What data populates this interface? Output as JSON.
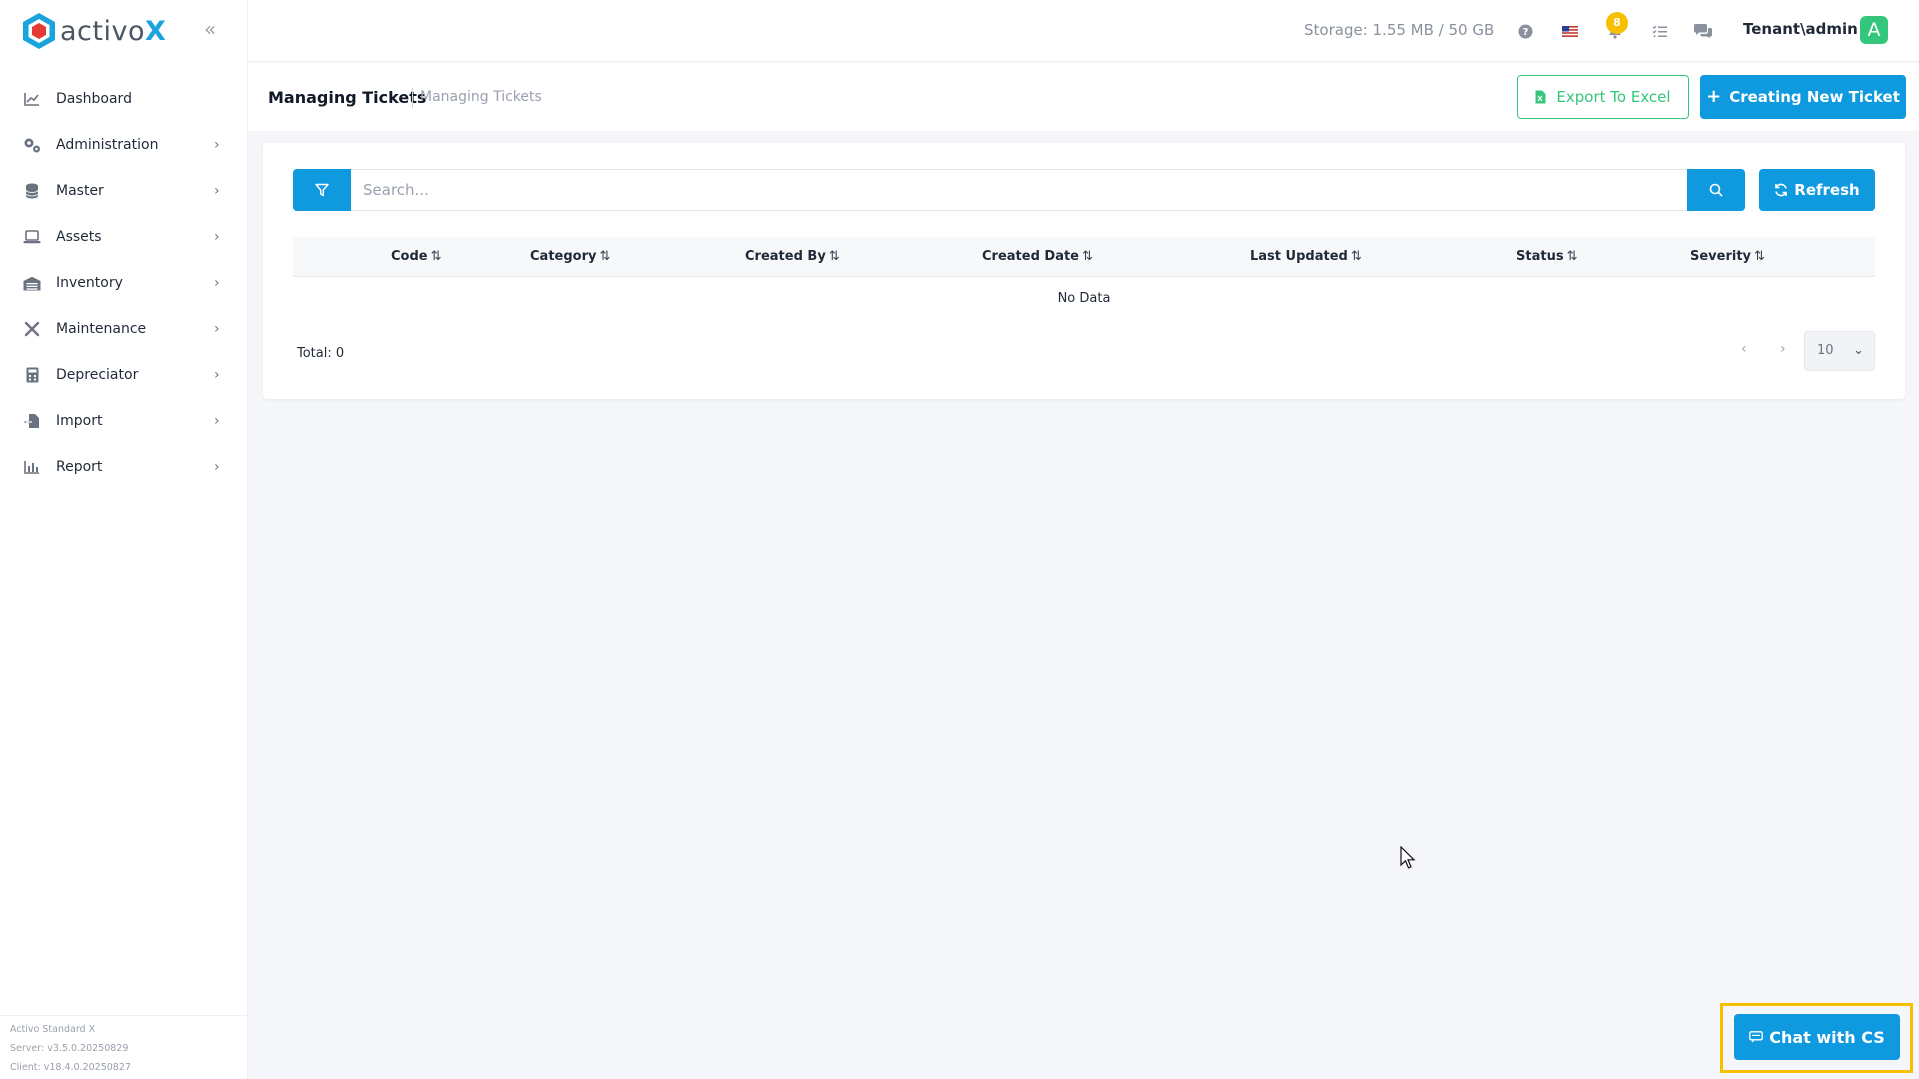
{
  "app": {
    "logo_text": "activo",
    "logo_x": "X"
  },
  "sidebar": {
    "collapse_icon": "double-chevron-left-icon",
    "items": [
      {
        "label": "Dashboard",
        "icon": "chart-line-icon",
        "has_children": false
      },
      {
        "label": "Administration",
        "icon": "gears-icon",
        "has_children": true
      },
      {
        "label": "Master",
        "icon": "database-icon",
        "has_children": true
      },
      {
        "label": "Assets",
        "icon": "laptop-icon",
        "has_children": true
      },
      {
        "label": "Inventory",
        "icon": "warehouse-icon",
        "has_children": true
      },
      {
        "label": "Maintenance",
        "icon": "tools-icon",
        "has_children": true
      },
      {
        "label": "Depreciator",
        "icon": "calculator-icon",
        "has_children": true
      },
      {
        "label": "Import",
        "icon": "file-import-icon",
        "has_children": true
      },
      {
        "label": "Report",
        "icon": "chart-bar-icon",
        "has_children": true
      }
    ],
    "version": {
      "product": "Activo Standard X",
      "server": "Server: v3.5.0.20250829",
      "client": "Client: v18.4.0.20250827"
    }
  },
  "topbar": {
    "storage": "Storage: 1.55 MB / 50 GB",
    "notification_count": "8",
    "user": "Tenant\\admin",
    "avatar_letter": "A"
  },
  "header": {
    "title": "Managing Tickets",
    "breadcrumb": "Managing Tickets",
    "export_label": "Export To Excel",
    "new_label": "Creating New Ticket"
  },
  "toolbar": {
    "search_placeholder": "Search...",
    "refresh_label": "Refresh"
  },
  "table": {
    "columns": [
      "Code",
      "Category",
      "Created By",
      "Created Date",
      "Last Updated",
      "Status",
      "Severity"
    ],
    "sort_glyph": "⇅",
    "empty_text": "No Data",
    "total": "Total: 0",
    "page_size": "10"
  },
  "chat": {
    "label": "Chat with CS"
  },
  "colors": {
    "primary": "#0f9ae0",
    "success": "#34c77b",
    "badge": "#f6c000",
    "highlight": "#f6c000"
  }
}
